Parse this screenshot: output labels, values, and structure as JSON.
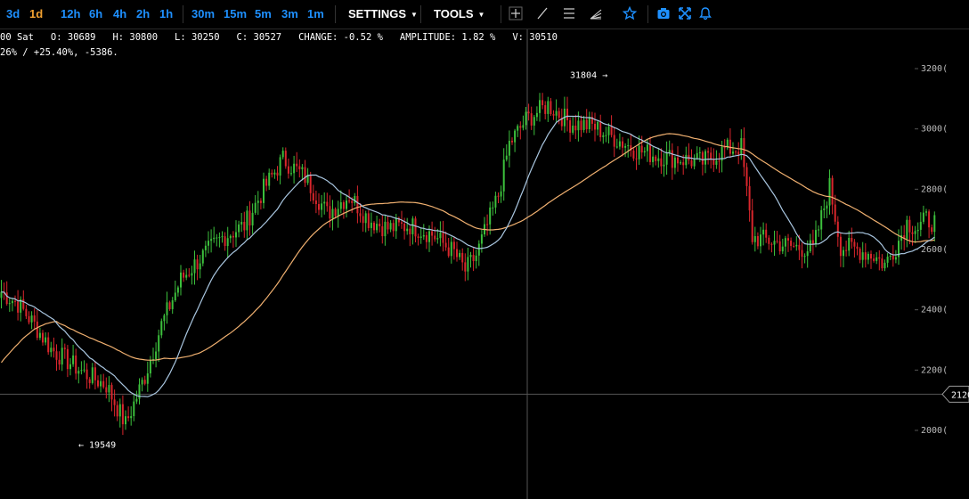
{
  "toolbar": {
    "timeframes": [
      "3d",
      "1d",
      "12h",
      "6h",
      "4h",
      "2h",
      "1h",
      "30m",
      "15m",
      "5m",
      "3m",
      "1m"
    ],
    "active_timeframe": "1d",
    "settings_label": "SETTINGS",
    "tools_label": "TOOLS",
    "icons": [
      "crosshair-icon",
      "line-draw-icon",
      "horizontal-lines-icon",
      "fib-fan-icon",
      "star-icon",
      "camera-icon",
      "expand-icon",
      "bell-icon"
    ],
    "accent": "#1e90ff",
    "active_color": "#f0a030"
  },
  "info": {
    "date_text": "00 Sat",
    "open": "O: 30689",
    "high": "H: 30800",
    "low": "L: 30250",
    "close": "C: 30527",
    "change": "CHANGE: -0.52 %",
    "amplitude": "AMPLITUDE: 1.82 %",
    "volume": "V: 30510",
    "range_text": "26% / +25.40%, -5386."
  },
  "chart_data": {
    "type": "candlestick",
    "ylim": [
      19000,
      32500
    ],
    "yticks": [
      20000,
      22000,
      24000,
      26000,
      28000,
      30000,
      32000
    ],
    "ytick_labels": [
      "2000(",
      "2200(",
      "2400(",
      "2600(",
      "2800(",
      "3000(",
      "3200("
    ],
    "grid": false,
    "annotations": [
      {
        "text": "31804 →",
        "value": 31804
      },
      {
        "text": "← 19549",
        "value": 19549
      }
    ],
    "crosshair_price": 21200,
    "crosshair_label": "2120",
    "colors": {
      "up": "#3cbf3c",
      "down": "#d9262c",
      "ma_short": "#a9c6e0",
      "ma_long": "#f0b070",
      "crosshair": "#555555"
    },
    "series": [
      {
        "name": "",
        "anchors": [
          [
            0,
            24600
          ],
          [
            6,
            24200
          ],
          [
            12,
            23500
          ],
          [
            18,
            22700
          ],
          [
            24,
            22300
          ],
          [
            30,
            21900
          ],
          [
            38,
            21500
          ],
          [
            45,
            20200
          ],
          [
            52,
            21800
          ],
          [
            58,
            23500
          ],
          [
            65,
            25000
          ],
          [
            72,
            25700
          ],
          [
            80,
            26400
          ],
          [
            88,
            26800
          ],
          [
            95,
            28000
          ],
          [
            102,
            29000
          ],
          [
            110,
            28400
          ],
          [
            118,
            27200
          ],
          [
            126,
            27800
          ],
          [
            133,
            27000
          ],
          [
            140,
            26700
          ],
          [
            148,
            26800
          ],
          [
            156,
            26500
          ],
          [
            164,
            25900
          ],
          [
            168,
            25300
          ],
          [
            172,
            25800
          ],
          [
            176,
            26800
          ],
          [
            180,
            27800
          ],
          [
            184,
            29500
          ],
          [
            190,
            30300
          ],
          [
            198,
            30800
          ],
          [
            206,
            30200
          ],
          [
            214,
            30100
          ],
          [
            222,
            29700
          ],
          [
            230,
            29300
          ],
          [
            238,
            29100
          ],
          [
            246,
            29000
          ],
          [
            254,
            28900
          ],
          [
            262,
            29300
          ],
          [
            268,
            29400
          ],
          [
            272,
            26400
          ],
          [
            278,
            26300
          ],
          [
            286,
            26100
          ],
          [
            294,
            26000
          ],
          [
            300,
            28100
          ],
          [
            304,
            26100
          ],
          [
            310,
            26000
          ],
          [
            316,
            25800
          ],
          [
            320,
            25500
          ],
          [
            324,
            26100
          ],
          [
            328,
            26900
          ],
          [
            332,
            26700
          ],
          [
            335,
            27000
          ],
          [
            338,
            26900
          ]
        ]
      }
    ]
  }
}
